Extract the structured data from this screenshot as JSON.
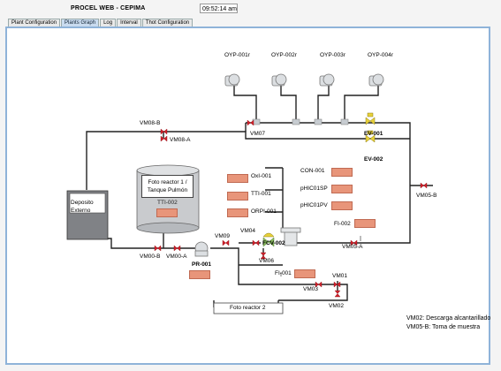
{
  "header": {
    "app_title": "PROCEL WEB - CEPIMA",
    "clock_time": "09:52:14 am"
  },
  "tabs": [
    {
      "label": "Plant Configuration",
      "active": false
    },
    {
      "label": "Plants Graph",
      "active": true
    },
    {
      "label": "Log",
      "active": false
    },
    {
      "label": "Interval",
      "active": false
    },
    {
      "label": "Thot Configuration",
      "active": false
    }
  ],
  "diagram": {
    "blowers": [
      "OYP-001r",
      "OYP-002r",
      "OYP-003r",
      "OYP-004r"
    ],
    "valves": {
      "vm08b": "VM08-B",
      "vm08a": "VM08-A",
      "vm07": "VM07",
      "ev001": "EV-001",
      "ev002": "EV-002",
      "vm05b": "VM05-B",
      "vm09": "VM09",
      "vm04": "VM04",
      "fcv002": "FCV-002",
      "vm06": "VM06",
      "vm05a": "VM05-A",
      "vm00b": "VM00-B",
      "vm00a": "VM00-A",
      "vm03": "VM03",
      "vm01": "VM01",
      "vm02": "VM02"
    },
    "tank": {
      "line1": "Foto reactor 1 /",
      "line2": "Tanque Pulmón",
      "tag": "TTI-002"
    },
    "deposit": {
      "line1": "Deposito",
      "line2": "Externo"
    },
    "pump": "PR-001",
    "sensors_left": [
      "OxI-001",
      "TTI-001",
      "ORPI-001"
    ],
    "sensors_right": [
      "CON-001",
      "pHIC01SP",
      "pHIC01PV"
    ],
    "fi002": "FI-002",
    "fi001": "FI-001",
    "reactor2": "Foto reactor 2"
  },
  "legend": {
    "line1": "VM02: Descarga alcantarillado",
    "line2": "VM05-B: Toma de muestra"
  },
  "colors": {
    "valve": "#d0202a",
    "box_fill": "#e8957a",
    "ev_valve": "#e8d13a",
    "fcv_valve": "#8fc064",
    "panel_border": "#8fb3d9"
  }
}
